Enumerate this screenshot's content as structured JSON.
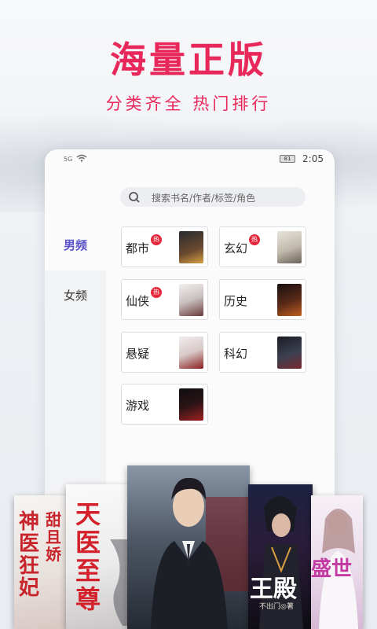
{
  "promo": {
    "headline": "海量正版",
    "subline": "分类齐全 热门排行"
  },
  "status": {
    "signal": "5G",
    "battery": "81",
    "time": "2:05"
  },
  "search": {
    "placeholder": "搜索书名/作者/标签/角色"
  },
  "sidebar": {
    "items": [
      {
        "label": "男频",
        "active": true
      },
      {
        "label": "女频",
        "active": false
      }
    ]
  },
  "categories": [
    {
      "label": "都市",
      "hot": "热"
    },
    {
      "label": "玄幻",
      "hot": "热"
    },
    {
      "label": "仙侠",
      "hot": "热"
    },
    {
      "label": "历史",
      "hot": ""
    },
    {
      "label": "悬疑",
      "hot": ""
    },
    {
      "label": "科幻",
      "hot": ""
    },
    {
      "label": "游戏",
      "hot": ""
    }
  ],
  "books": [
    {
      "title": "神医狂妃",
      "subtitle": "甜且娇"
    },
    {
      "title": "天医至尊",
      "subtitle": ""
    },
    {
      "title": "",
      "subtitle": ""
    },
    {
      "title": "王殿",
      "subtitle": "不出门◎著"
    },
    {
      "title": "盛世",
      "subtitle": ""
    }
  ],
  "colors": {
    "accent": "#e8285a",
    "active_tab": "#5a52c8",
    "hot_badge": "#e5293c"
  }
}
